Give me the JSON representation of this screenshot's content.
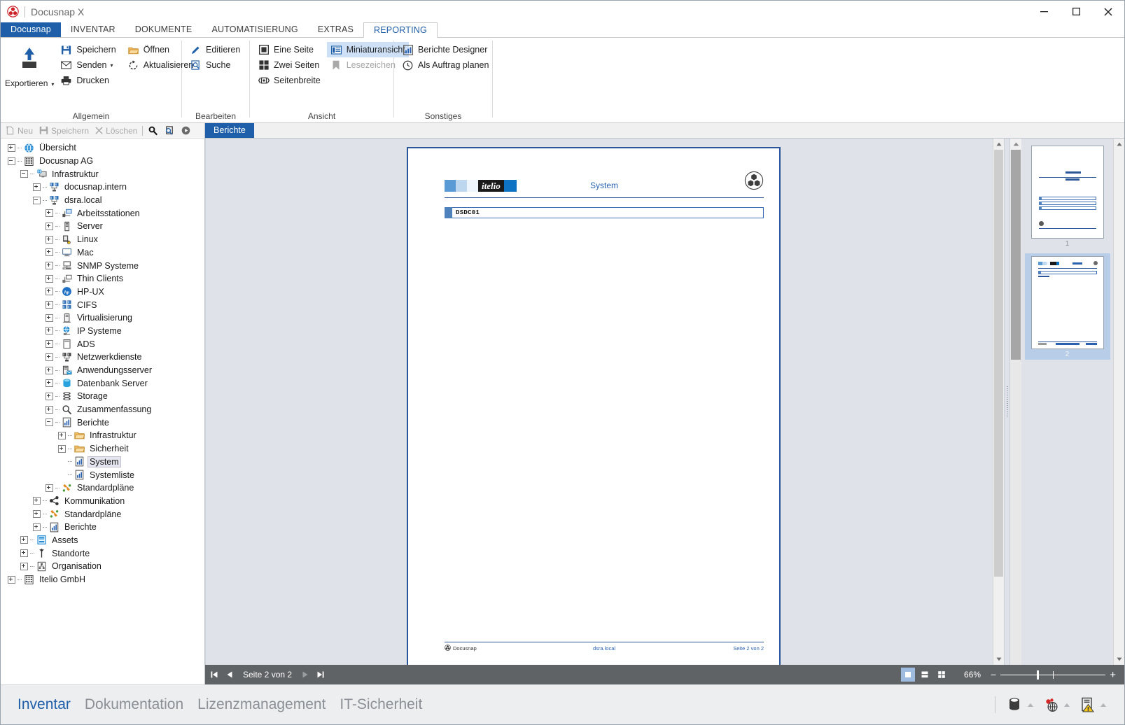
{
  "window": {
    "title": "Docusnap X",
    "app_icon": "docusnap-logo-icon",
    "minimize": "─",
    "maximize": "□",
    "close": "✕"
  },
  "ribbon": {
    "tabs": [
      {
        "label": "Docusnap",
        "type": "home"
      },
      {
        "label": "INVENTAR",
        "type": "normal"
      },
      {
        "label": "DOKUMENTE",
        "type": "normal"
      },
      {
        "label": "AUTOMATISIERUNG",
        "type": "normal"
      },
      {
        "label": "EXTRAS",
        "type": "normal"
      },
      {
        "label": "REPORTING",
        "type": "active"
      }
    ],
    "groups": [
      {
        "label": "Allgemein",
        "big": {
          "label": "Exportieren",
          "icon": "export-up-arrow-icon",
          "caret": "▾"
        },
        "columns": [
          [
            {
              "label": "Speichern",
              "icon": "save-floppy-icon",
              "state": "enabled"
            },
            {
              "label": "Senden",
              "icon": "mail-envelope-icon",
              "state": "enabled",
              "caret": "▾"
            },
            {
              "label": "Drucken",
              "icon": "printer-icon",
              "state": "enabled"
            }
          ],
          [
            {
              "label": "Öffnen",
              "icon": "folder-open-icon",
              "state": "enabled"
            },
            {
              "label": "Aktualisieren",
              "icon": "refresh-icon",
              "state": "enabled"
            }
          ]
        ]
      },
      {
        "label": "Bearbeiten",
        "columns": [
          [
            {
              "label": "Editieren",
              "icon": "pencil-edit-icon",
              "state": "enabled"
            },
            {
              "label": "Suche",
              "icon": "find-page-icon",
              "state": "enabled"
            }
          ]
        ]
      },
      {
        "label": "Ansicht",
        "columns": [
          [
            {
              "label": "Eine Seite",
              "icon": "one-page-icon",
              "state": "enabled"
            },
            {
              "label": "Zwei Seiten",
              "icon": "two-pages-icon",
              "state": "enabled"
            },
            {
              "label": "Seitenbreite",
              "icon": "page-width-icon",
              "state": "enabled"
            }
          ],
          [
            {
              "label": "Miniaturansicht",
              "icon": "thumbnail-view-icon",
              "state": "selected"
            },
            {
              "label": "Lesezeichen",
              "icon": "bookmark-icon",
              "state": "disabled"
            }
          ]
        ]
      },
      {
        "label": "Sonstiges",
        "columns": [
          [
            {
              "label": "Berichte Designer",
              "icon": "report-designer-icon",
              "state": "enabled"
            },
            {
              "label": "Als Auftrag planen",
              "icon": "clock-schedule-icon",
              "state": "enabled"
            }
          ]
        ]
      }
    ]
  },
  "tree_toolbar": {
    "items": [
      {
        "label": "Neu",
        "icon": "new-document-icon",
        "state": "disabled"
      },
      {
        "label": "Speichern",
        "icon": "save-floppy-icon",
        "state": "disabled"
      },
      {
        "label": "Löschen",
        "icon": "delete-x-icon",
        "state": "disabled"
      },
      {
        "label": "",
        "icon": "search-key-icon",
        "state": "enabled"
      },
      {
        "label": "",
        "icon": "find-page-icon",
        "state": "enabled"
      },
      {
        "label": "",
        "icon": "play-circle-icon",
        "state": "enabled"
      }
    ]
  },
  "tree": {
    "nodes": [
      {
        "label": "Übersicht",
        "depth": 0,
        "expander": "plus",
        "icon": "globe-icon",
        "selected": false
      },
      {
        "label": "Docusnap AG",
        "depth": 0,
        "expander": "minus",
        "icon": "company-building-icon",
        "selected": false
      },
      {
        "label": "Infrastruktur",
        "depth": 1,
        "expander": "minus",
        "icon": "infrastructure-monitor-icon",
        "selected": false
      },
      {
        "label": "docusnap.intern",
        "depth": 2,
        "expander": "plus",
        "icon": "domain-servers-icon",
        "selected": false
      },
      {
        "label": "dsra.local",
        "depth": 2,
        "expander": "minus",
        "icon": "domain-servers-icon",
        "selected": false
      },
      {
        "label": "Arbeitsstationen",
        "depth": 3,
        "expander": "plus",
        "icon": "workstation-icon",
        "selected": false
      },
      {
        "label": "Server",
        "depth": 3,
        "expander": "plus",
        "icon": "server-tower-icon",
        "selected": false
      },
      {
        "label": "Linux",
        "depth": 3,
        "expander": "plus",
        "icon": "linux-icon",
        "selected": false
      },
      {
        "label": "Mac",
        "depth": 3,
        "expander": "plus",
        "icon": "mac-monitor-icon",
        "selected": false
      },
      {
        "label": "SNMP Systeme",
        "depth": 3,
        "expander": "plus",
        "icon": "snmp-system-icon",
        "selected": false
      },
      {
        "label": "Thin Clients",
        "depth": 3,
        "expander": "plus",
        "icon": "thin-client-icon",
        "selected": false
      },
      {
        "label": "HP-UX",
        "depth": 3,
        "expander": "plus",
        "icon": "hp-icon",
        "selected": false
      },
      {
        "label": "CIFS",
        "depth": 3,
        "expander": "plus",
        "icon": "cifs-share-icon",
        "selected": false
      },
      {
        "label": "Virtualisierung",
        "depth": 3,
        "expander": "plus",
        "icon": "virtualization-icon",
        "selected": false
      },
      {
        "label": "IP Systeme",
        "depth": 3,
        "expander": "plus",
        "icon": "ip-system-icon",
        "selected": false
      },
      {
        "label": "ADS",
        "depth": 3,
        "expander": "plus",
        "icon": "ads-directory-icon",
        "selected": false
      },
      {
        "label": "Netzwerkdienste",
        "depth": 3,
        "expander": "plus",
        "icon": "network-services-icon",
        "selected": false
      },
      {
        "label": "Anwendungsserver",
        "depth": 3,
        "expander": "plus",
        "icon": "application-server-icon",
        "selected": false
      },
      {
        "label": "Datenbank Server",
        "depth": 3,
        "expander": "plus",
        "icon": "database-icon",
        "selected": false
      },
      {
        "label": "Storage",
        "depth": 3,
        "expander": "plus",
        "icon": "storage-stack-icon",
        "selected": false
      },
      {
        "label": "Zusammenfassung",
        "depth": 3,
        "expander": "plus",
        "icon": "magnifier-icon",
        "selected": false
      },
      {
        "label": "Berichte",
        "depth": 3,
        "expander": "minus",
        "icon": "report-chart-icon",
        "selected": false
      },
      {
        "label": "Infrastruktur",
        "depth": 4,
        "expander": "plus",
        "icon": "folder-icon",
        "selected": false
      },
      {
        "label": "Sicherheit",
        "depth": 4,
        "expander": "plus",
        "icon": "folder-icon",
        "selected": false
      },
      {
        "label": "System",
        "depth": 4,
        "expander": "leaf",
        "icon": "report-chart-icon",
        "selected": true
      },
      {
        "label": "Systemliste",
        "depth": 4,
        "expander": "leaf",
        "icon": "report-chart-icon",
        "selected": false
      },
      {
        "label": "Standardpläne",
        "depth": 3,
        "expander": "plus",
        "icon": "plans-icon",
        "selected": false
      },
      {
        "label": "Kommunikation",
        "depth": 2,
        "expander": "plus",
        "icon": "communication-share-icon",
        "selected": false
      },
      {
        "label": "Standardpläne",
        "depth": 2,
        "expander": "plus",
        "icon": "plans-icon",
        "selected": false
      },
      {
        "label": "Berichte",
        "depth": 2,
        "expander": "plus",
        "icon": "report-chart-icon",
        "selected": false
      },
      {
        "label": "Assets",
        "depth": 1,
        "expander": "plus",
        "icon": "assets-icon",
        "selected": false
      },
      {
        "label": "Standorte",
        "depth": 1,
        "expander": "plus",
        "icon": "location-pin-icon",
        "selected": false
      },
      {
        "label": "Organisation",
        "depth": 1,
        "expander": "plus",
        "icon": "organisation-chart-icon",
        "selected": false
      },
      {
        "label": "Itelio GmbH",
        "depth": 0,
        "expander": "plus",
        "icon": "company-building-icon",
        "selected": false
      }
    ]
  },
  "document": {
    "tab_label": "Berichte",
    "report": {
      "brand": "itelio",
      "title": "System",
      "logo": "docusnap-circle-logo-icon",
      "row_value": "DSDC01",
      "footer_left": "Docusnap",
      "footer_center": "dsra.local",
      "footer_right": "Seite 2 von 2"
    },
    "thumbnails": [
      {
        "number": "1",
        "selected": false
      },
      {
        "number": "2",
        "selected": true
      }
    ]
  },
  "statusbar": {
    "first_page_icon": "first-page-icon",
    "prev_page_icon": "prev-page-icon",
    "page_label": "Seite 2 von 2",
    "next_page_icon": "next-page-icon",
    "last_page_icon": "last-page-icon",
    "view_modes": [
      {
        "icon": "single-page-mode-icon",
        "selected": true
      },
      {
        "icon": "continuous-page-mode-icon",
        "selected": false
      },
      {
        "icon": "multi-page-mode-icon",
        "selected": false
      }
    ],
    "zoom_level": "66%",
    "zoom_out": "−",
    "zoom_in": "+"
  },
  "modulebar": {
    "modules": [
      {
        "label": "Inventar",
        "active": true
      },
      {
        "label": "Dokumentation",
        "active": false
      },
      {
        "label": "Lizenzmanagement",
        "active": false
      },
      {
        "label": "IT-Sicherheit",
        "active": false
      }
    ],
    "tray_icons": [
      {
        "icon": "database-status-icon"
      },
      {
        "icon": "discovery-network-icon"
      },
      {
        "icon": "server-warning-icon"
      }
    ]
  }
}
